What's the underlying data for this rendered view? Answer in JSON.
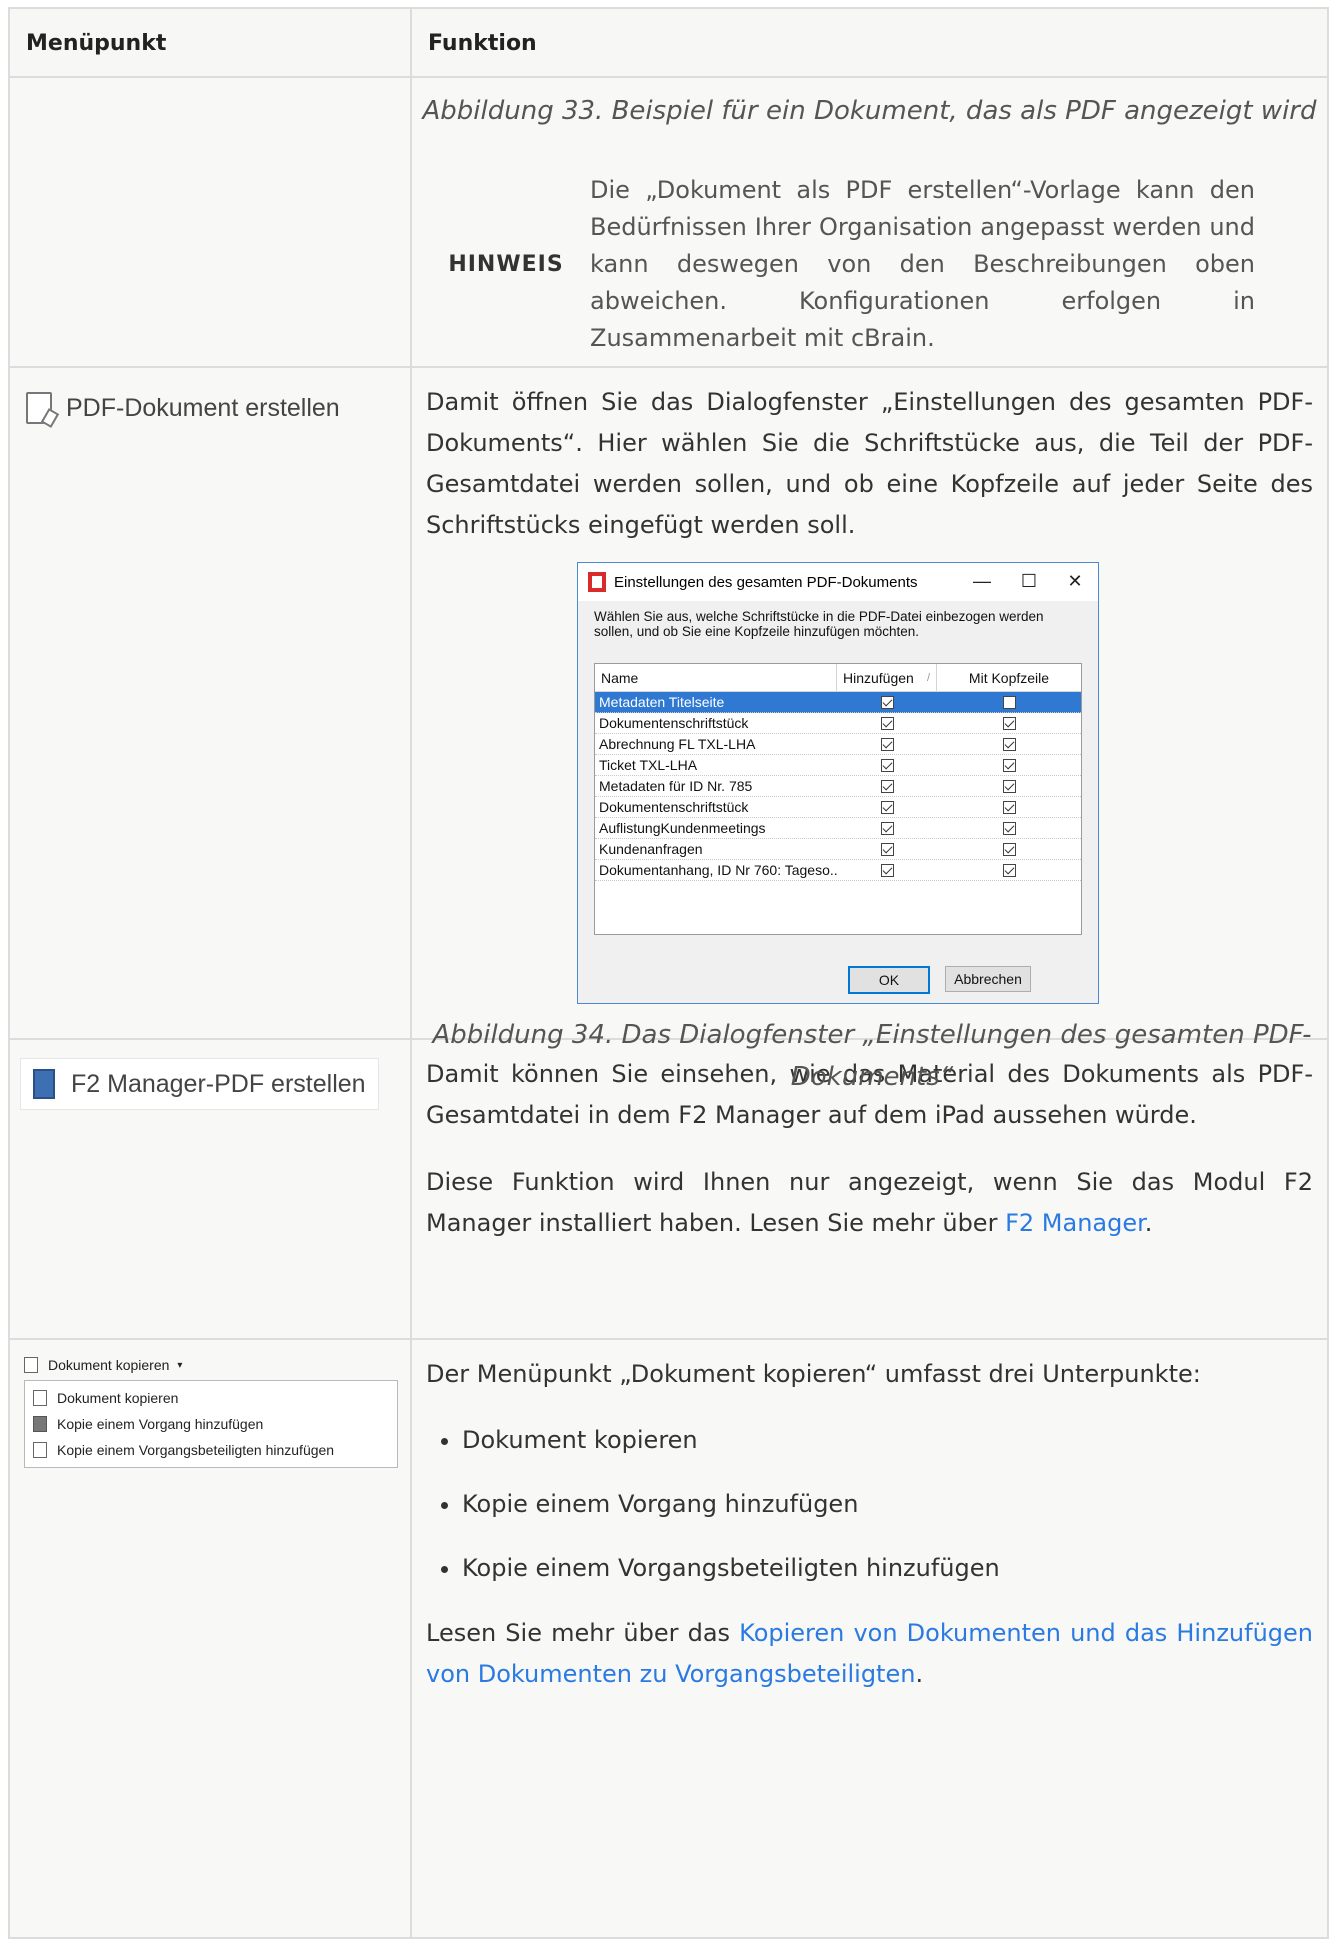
{
  "header": {
    "col1": "Menüpunkt",
    "col2": "Funktion"
  },
  "row1": {
    "caption": "Abbildung 33. Beispiel für ein Dokument, das als PDF angezeigt wird",
    "note_label": "HINWEIS",
    "note_text": "Die „Dokument als PDF erstellen“-Vorlage kann den Bedürfnissen Ihrer Organisation angepasst werden und kann deswegen von den Beschreibungen oben abweichen. Konfigurationen erfolgen in Zusammenarbeit mit cBrain."
  },
  "row2": {
    "menu_label": "PDF-Dokument erstellen",
    "text": "Damit öffnen Sie das Dialogfenster „Einstellungen des gesamten PDF-Dokuments“. Hier wählen Sie die Schriftstücke aus, die Teil der PDF-Gesamtdatei werden sollen, und ob eine Kopfzeile auf jeder Seite des Schriftstücks eingefügt werden soll.",
    "dialog": {
      "title": "Einstellungen des gesamten PDF-Dokuments",
      "minimize": "—",
      "maximize": "☐",
      "close": "✕",
      "description": "Wählen Sie aus, welche Schriftstücke in die PDF-Datei einbezogen werden sollen, und ob Sie eine Kopfzeile hinzufügen möchten.",
      "columns": {
        "name": "Name",
        "add": "Hinzufügen",
        "sort": "/",
        "header": "Mit Kopfzeile"
      },
      "rows": [
        {
          "name": "Metadaten Titelseite",
          "add": true,
          "header": false,
          "selected": true
        },
        {
          "name": "Dokumentenschriftstück",
          "add": true,
          "header": true,
          "selected": false
        },
        {
          "name": "Abrechnung FL TXL-LHA",
          "add": true,
          "header": true,
          "selected": false
        },
        {
          "name": "Ticket TXL-LHA",
          "add": true,
          "header": true,
          "selected": false
        },
        {
          "name": "Metadaten für ID Nr. 785",
          "add": true,
          "header": true,
          "selected": false
        },
        {
          "name": "Dokumentenschriftstück",
          "add": true,
          "header": true,
          "selected": false
        },
        {
          "name": "AuflistungKundenmeetings",
          "add": true,
          "header": true,
          "selected": false
        },
        {
          "name": "Kundenanfragen",
          "add": true,
          "header": true,
          "selected": false
        },
        {
          "name": "Dokumentanhang, ID Nr 760: Tageso...",
          "add": true,
          "header": true,
          "selected": false
        }
      ],
      "ok": "OK",
      "cancel": "Abbrechen"
    },
    "caption": "Abbildung 34. Das Dialogfenster „Einstellungen des gesamten PDF-Dokuments“"
  },
  "row3": {
    "menu_label": "F2 Manager-PDF erstellen",
    "text1": "Damit können Sie einsehen, wie das Material des Dokuments als PDF-Gesamtdatei in dem F2 Manager auf dem iPad aussehen würde.",
    "text2_prefix": "Diese Funktion wird Ihnen nur angezeigt, wenn Sie das Modul F2 Manager installiert haben. Lesen Sie mehr über ",
    "text2_link": "F2 Manager",
    "text2_suffix": "."
  },
  "row4": {
    "menu_button": "Dokument kopieren",
    "menu_caret": "▾",
    "menu_items": [
      "Dokument kopieren",
      "Kopie einem Vorgang hinzufügen",
      "Kopie einem Vorgangsbeteiligten hinzufügen"
    ],
    "intro": "Der Menüpunkt „Dokument kopieren“ umfasst drei Unterpunkte:",
    "bullets": [
      "Dokument kopieren",
      "Kopie einem Vorgang hinzufügen",
      "Kopie einem Vorgangsbeteiligten hinzufügen"
    ],
    "more_prefix": "Lesen Sie mehr über das ",
    "more_link": "Kopieren von Dokumenten und das Hinzufügen von Dokumenten zu Vorgangsbeteiligten",
    "more_suffix": "."
  }
}
